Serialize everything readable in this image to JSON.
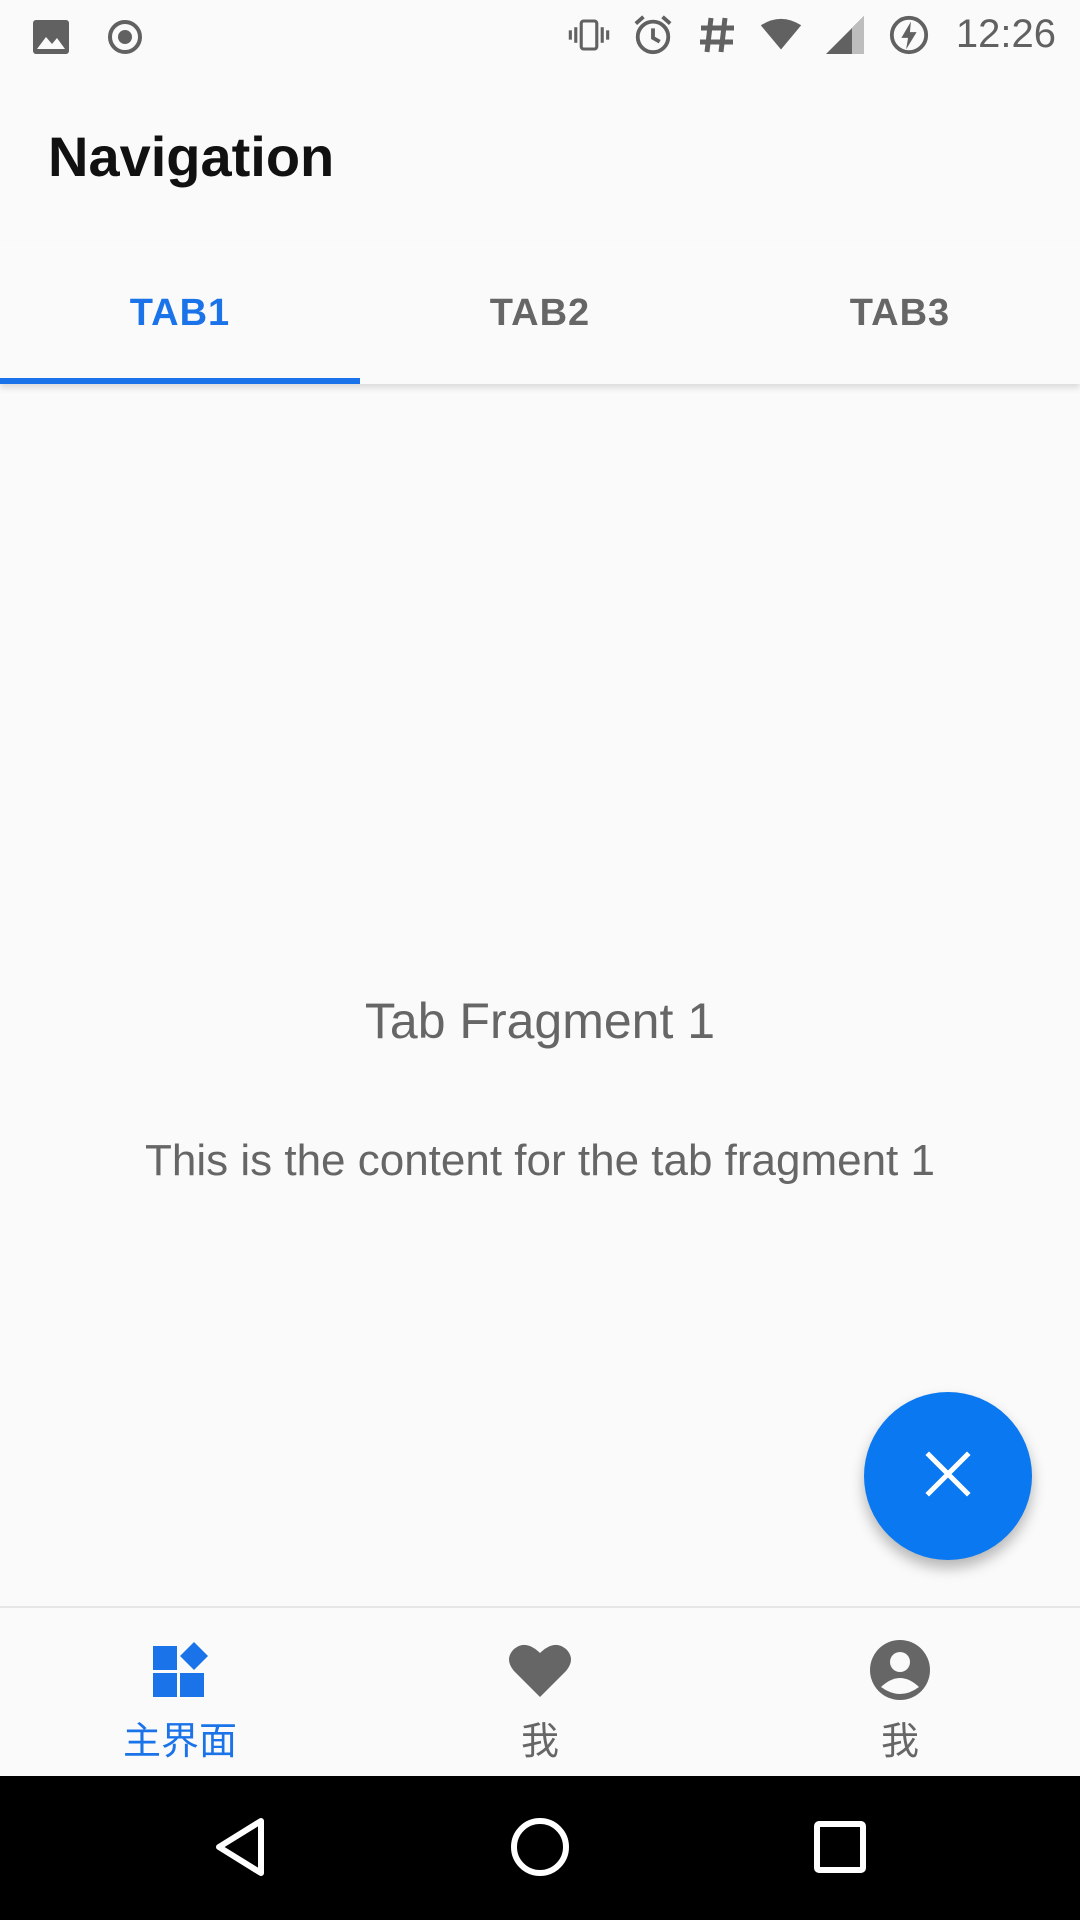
{
  "status_bar": {
    "time": "12:26",
    "left_icons": [
      "image-icon",
      "record-icon"
    ],
    "right_icons": [
      "vibrate-icon",
      "alarm-icon",
      "hash-icon",
      "wifi-icon",
      "signal-icon",
      "battery-charging-icon"
    ]
  },
  "app_bar": {
    "title": "Navigation"
  },
  "tabs": [
    {
      "label": "TAB1",
      "active": true
    },
    {
      "label": "TAB2",
      "active": false
    },
    {
      "label": "TAB3",
      "active": false
    }
  ],
  "content": {
    "title": "Tab Fragment 1",
    "body": "This is the content for the tab fragment 1"
  },
  "fab": {
    "icon": "close-icon"
  },
  "bottom_nav": [
    {
      "label": "主界面",
      "icon": "dashboard-icon",
      "active": true
    },
    {
      "label": "我",
      "icon": "heart-icon",
      "active": false
    },
    {
      "label": "我",
      "icon": "account-circle-icon",
      "active": false
    }
  ],
  "colors": {
    "accent": "#1a73e8",
    "fab": "#0a78f0",
    "text_secondary": "#666666"
  }
}
